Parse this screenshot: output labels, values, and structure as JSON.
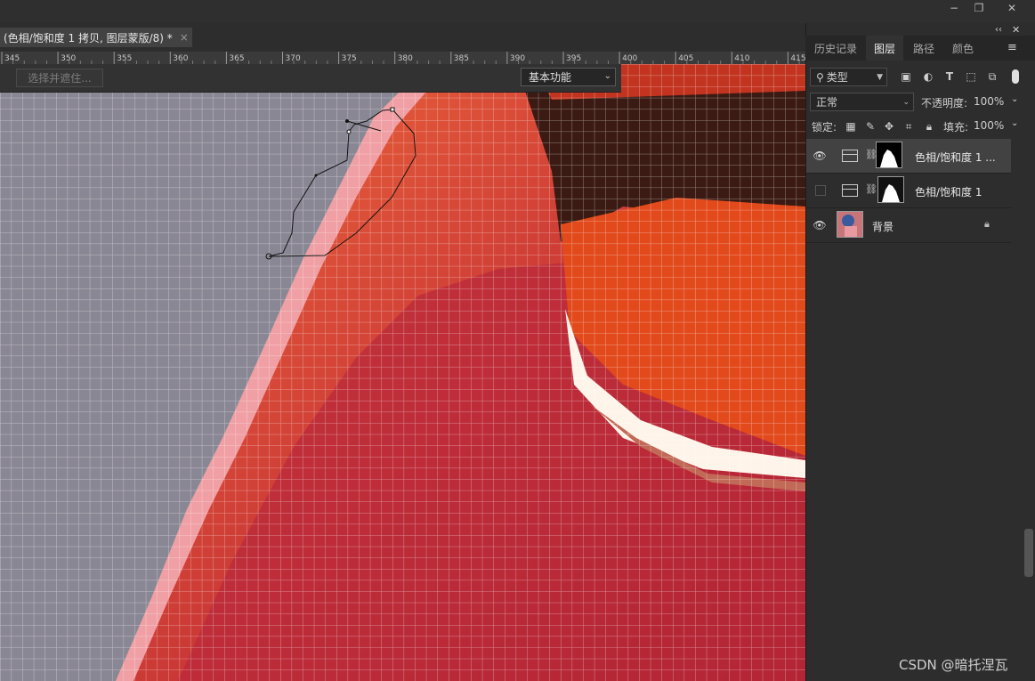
{
  "window": {
    "minimize": "−",
    "restore": "❐",
    "close": "✕"
  },
  "document": {
    "tab_title": "(色相/饱和度 1 拷贝, 图层蒙版/8) *",
    "tab_close": "×"
  },
  "ruler": {
    "ticks": [
      "345",
      "350",
      "355",
      "360",
      "365",
      "370",
      "375",
      "380",
      "385",
      "390",
      "395",
      "400",
      "405",
      "410",
      "415"
    ]
  },
  "options_bar": {
    "refine_edge": "选择并遮住...",
    "workspace": "基本功能"
  },
  "panel": {
    "collapse": "‹‹",
    "close": "✕",
    "menu": "≡",
    "tabs": [
      "历史记录",
      "图层",
      "路径",
      "颜色"
    ],
    "active_tab": "图层",
    "filter": {
      "label": "类型",
      "icons": [
        "image-filter-icon",
        "adjustment-filter-icon",
        "type-filter-icon",
        "shape-filter-icon",
        "smart-object-filter-icon"
      ]
    },
    "blend_mode": "正常",
    "opacity_label": "不透明度:",
    "opacity_value": "100%",
    "lock_label": "锁定:",
    "fill_label": "填充:",
    "fill_value": "100%",
    "layers": [
      {
        "name": "色相/饱和度 1 ...",
        "visible": true,
        "selected": true,
        "kind": "adjustment"
      },
      {
        "name": "色相/饱和度 1",
        "visible": false,
        "selected": false,
        "kind": "adjustment"
      },
      {
        "name": "背景",
        "visible": true,
        "selected": false,
        "kind": "background",
        "locked": true
      }
    ]
  },
  "watermark": "CSDN @暗托涅瓦"
}
